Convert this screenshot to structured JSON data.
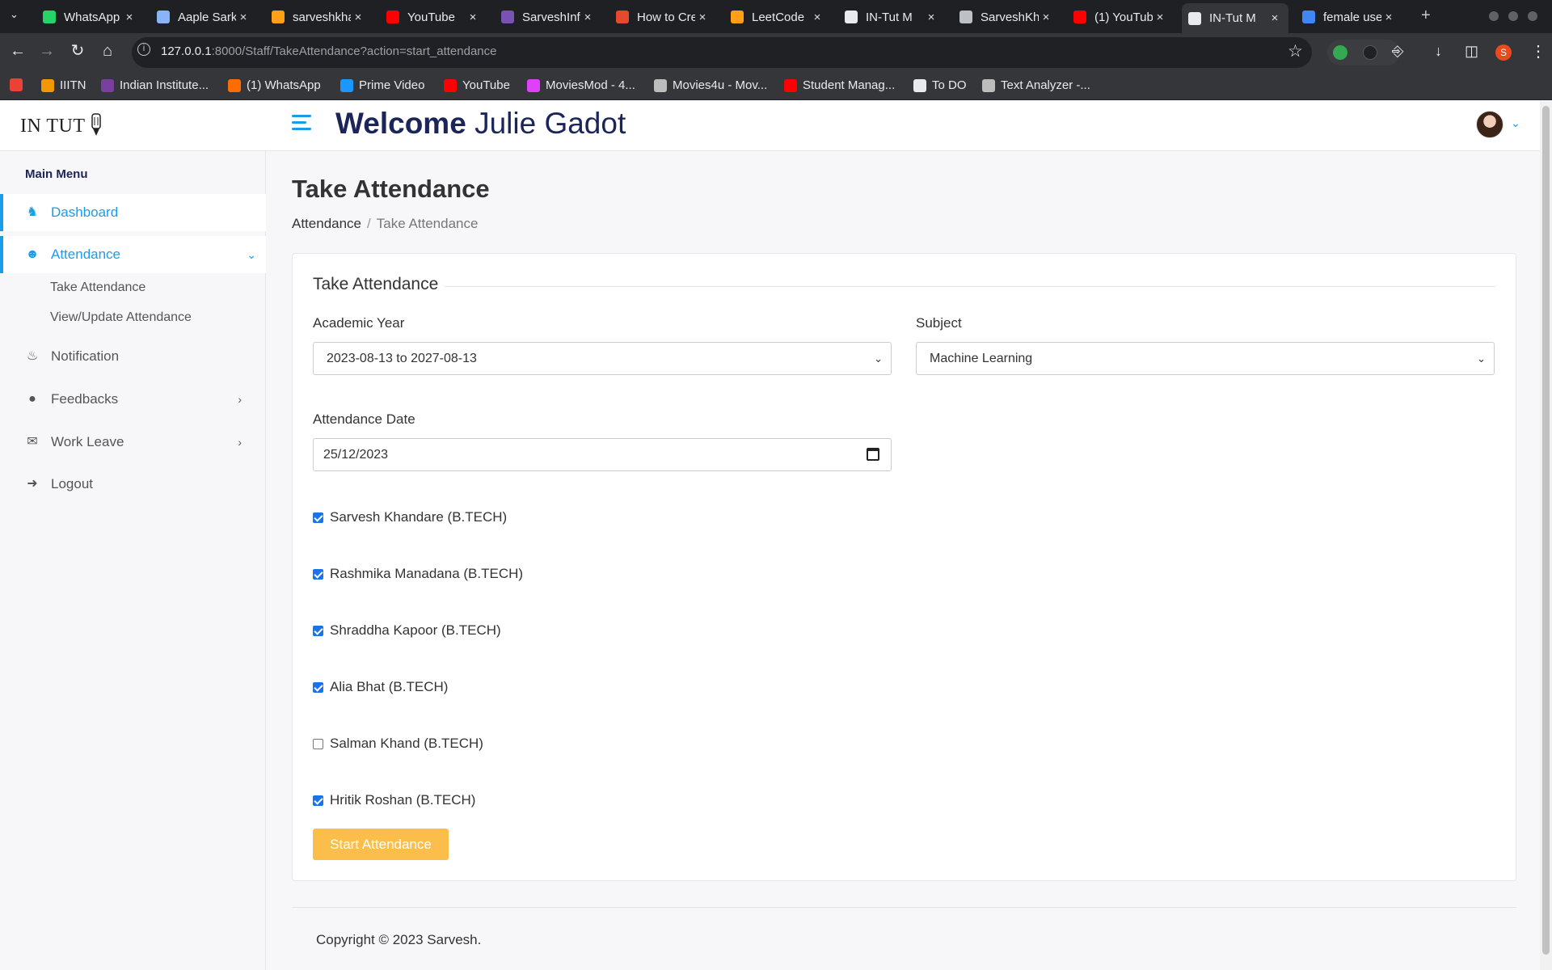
{
  "browser": {
    "tabs": [
      {
        "label": "WhatsApp",
        "icon": "whatsapp-icon",
        "color": "#25d366"
      },
      {
        "label": "Aaple Sarkar",
        "icon": "document-icon",
        "color": "#8ab4f8"
      },
      {
        "label": "sarveshkhandare",
        "icon": "leetcode-icon",
        "color": "#ffa116"
      },
      {
        "label": "YouTube",
        "icon": "youtube-icon",
        "color": "#ff0000"
      },
      {
        "label": "SarveshInfo",
        "icon": "bootstrap-icon",
        "color": "#7952b3"
      },
      {
        "label": "How to Create",
        "icon": "hashnode-icon",
        "color": "#e64a2e"
      },
      {
        "label": "LeetCode",
        "icon": "leetcode-icon",
        "color": "#ffa116"
      },
      {
        "label": "IN-Tut M",
        "icon": "intut-icon",
        "color": "#e8eaed"
      },
      {
        "label": "SarveshKhandare",
        "icon": "github-icon",
        "color": "#bdc1c6"
      },
      {
        "label": "(1) YouTube",
        "icon": "youtube-icon",
        "color": "#ff0000"
      },
      {
        "label": "IN-Tut M",
        "icon": "intut-icon",
        "color": "#e8eaed"
      },
      {
        "label": "female user",
        "icon": "google-icon",
        "color": "#4285f4"
      }
    ],
    "active_tab_index": 10,
    "url_host": "127.0.0.1",
    "url_path": ":8000/Staff/TakeAttendance?action=start_attendance",
    "profile_initial": "S",
    "bookmarks": [
      {
        "label": "",
        "icon": "gmail-icon",
        "color": "#ea4335"
      },
      {
        "label": "IIITN",
        "icon": "iiitn-icon",
        "color": "#f29900"
      },
      {
        "label": "Indian Institute...",
        "icon": "institute-icon",
        "color": "#7b3fa0"
      },
      {
        "label": "(1) WhatsApp",
        "icon": "whatsapp-icon",
        "color": "#ff6d00"
      },
      {
        "label": "Prime Video",
        "icon": "prime-video-icon",
        "color": "#1a98ff"
      },
      {
        "label": "YouTube",
        "icon": "youtube-icon",
        "color": "#ff0000"
      },
      {
        "label": "MoviesMod - 4...",
        "icon": "moviesmod-icon",
        "color": "#e040fb"
      },
      {
        "label": "Movies4u - Mov...",
        "icon": "movies4u-icon",
        "color": "#bdbdbd"
      },
      {
        "label": "Student Manag...",
        "icon": "youtube-icon",
        "color": "#ff0000"
      },
      {
        "label": "To DO",
        "icon": "globe-icon",
        "color": "#e8eaed"
      },
      {
        "label": "Text Analyzer -...",
        "icon": "gear-icon",
        "color": "#bdbdbd"
      }
    ]
  },
  "sidebar": {
    "logo": "IN TUT",
    "menu_title": "Main Menu",
    "items": {
      "dashboard": "Dashboard",
      "attendance": "Attendance",
      "take_attendance": "Take Attendance",
      "view_update": "View/Update Attendance",
      "notification": "Notification",
      "feedbacks": "Feedbacks",
      "work_leave": "Work Leave",
      "logout": "Logout"
    }
  },
  "header": {
    "welcome": "Welcome",
    "user_name": "Julie Gadot"
  },
  "page": {
    "title": "Take Attendance",
    "breadcrumb": [
      "Attendance",
      "Take Attendance"
    ]
  },
  "form": {
    "legend": "Take Attendance",
    "academic_year_label": "Academic Year",
    "academic_year_value": "2023-08-13 to 2027-08-13",
    "subject_label": "Subject",
    "subject_value": "Machine Learning",
    "date_label": "Attendance Date",
    "date_value": "25/12/2023",
    "students": [
      {
        "name": "Sarvesh Khandare (B.TECH)",
        "checked": true
      },
      {
        "name": "Rashmika Manadana (B.TECH)",
        "checked": true
      },
      {
        "name": "Shraddha Kapoor (B.TECH)",
        "checked": true
      },
      {
        "name": "Alia Bhat (B.TECH)",
        "checked": true
      },
      {
        "name": "Salman Khand (B.TECH)",
        "checked": false
      },
      {
        "name": "Hritik Roshan (B.TECH)",
        "checked": true
      }
    ],
    "submit_label": "Start Attendance"
  },
  "footer": {
    "copyright": "Copyright © 2023 Sarvesh."
  },
  "colors": {
    "accent": "#1b9ce8",
    "button": "#fbbe4b",
    "checkbox": "#1a73e8"
  }
}
